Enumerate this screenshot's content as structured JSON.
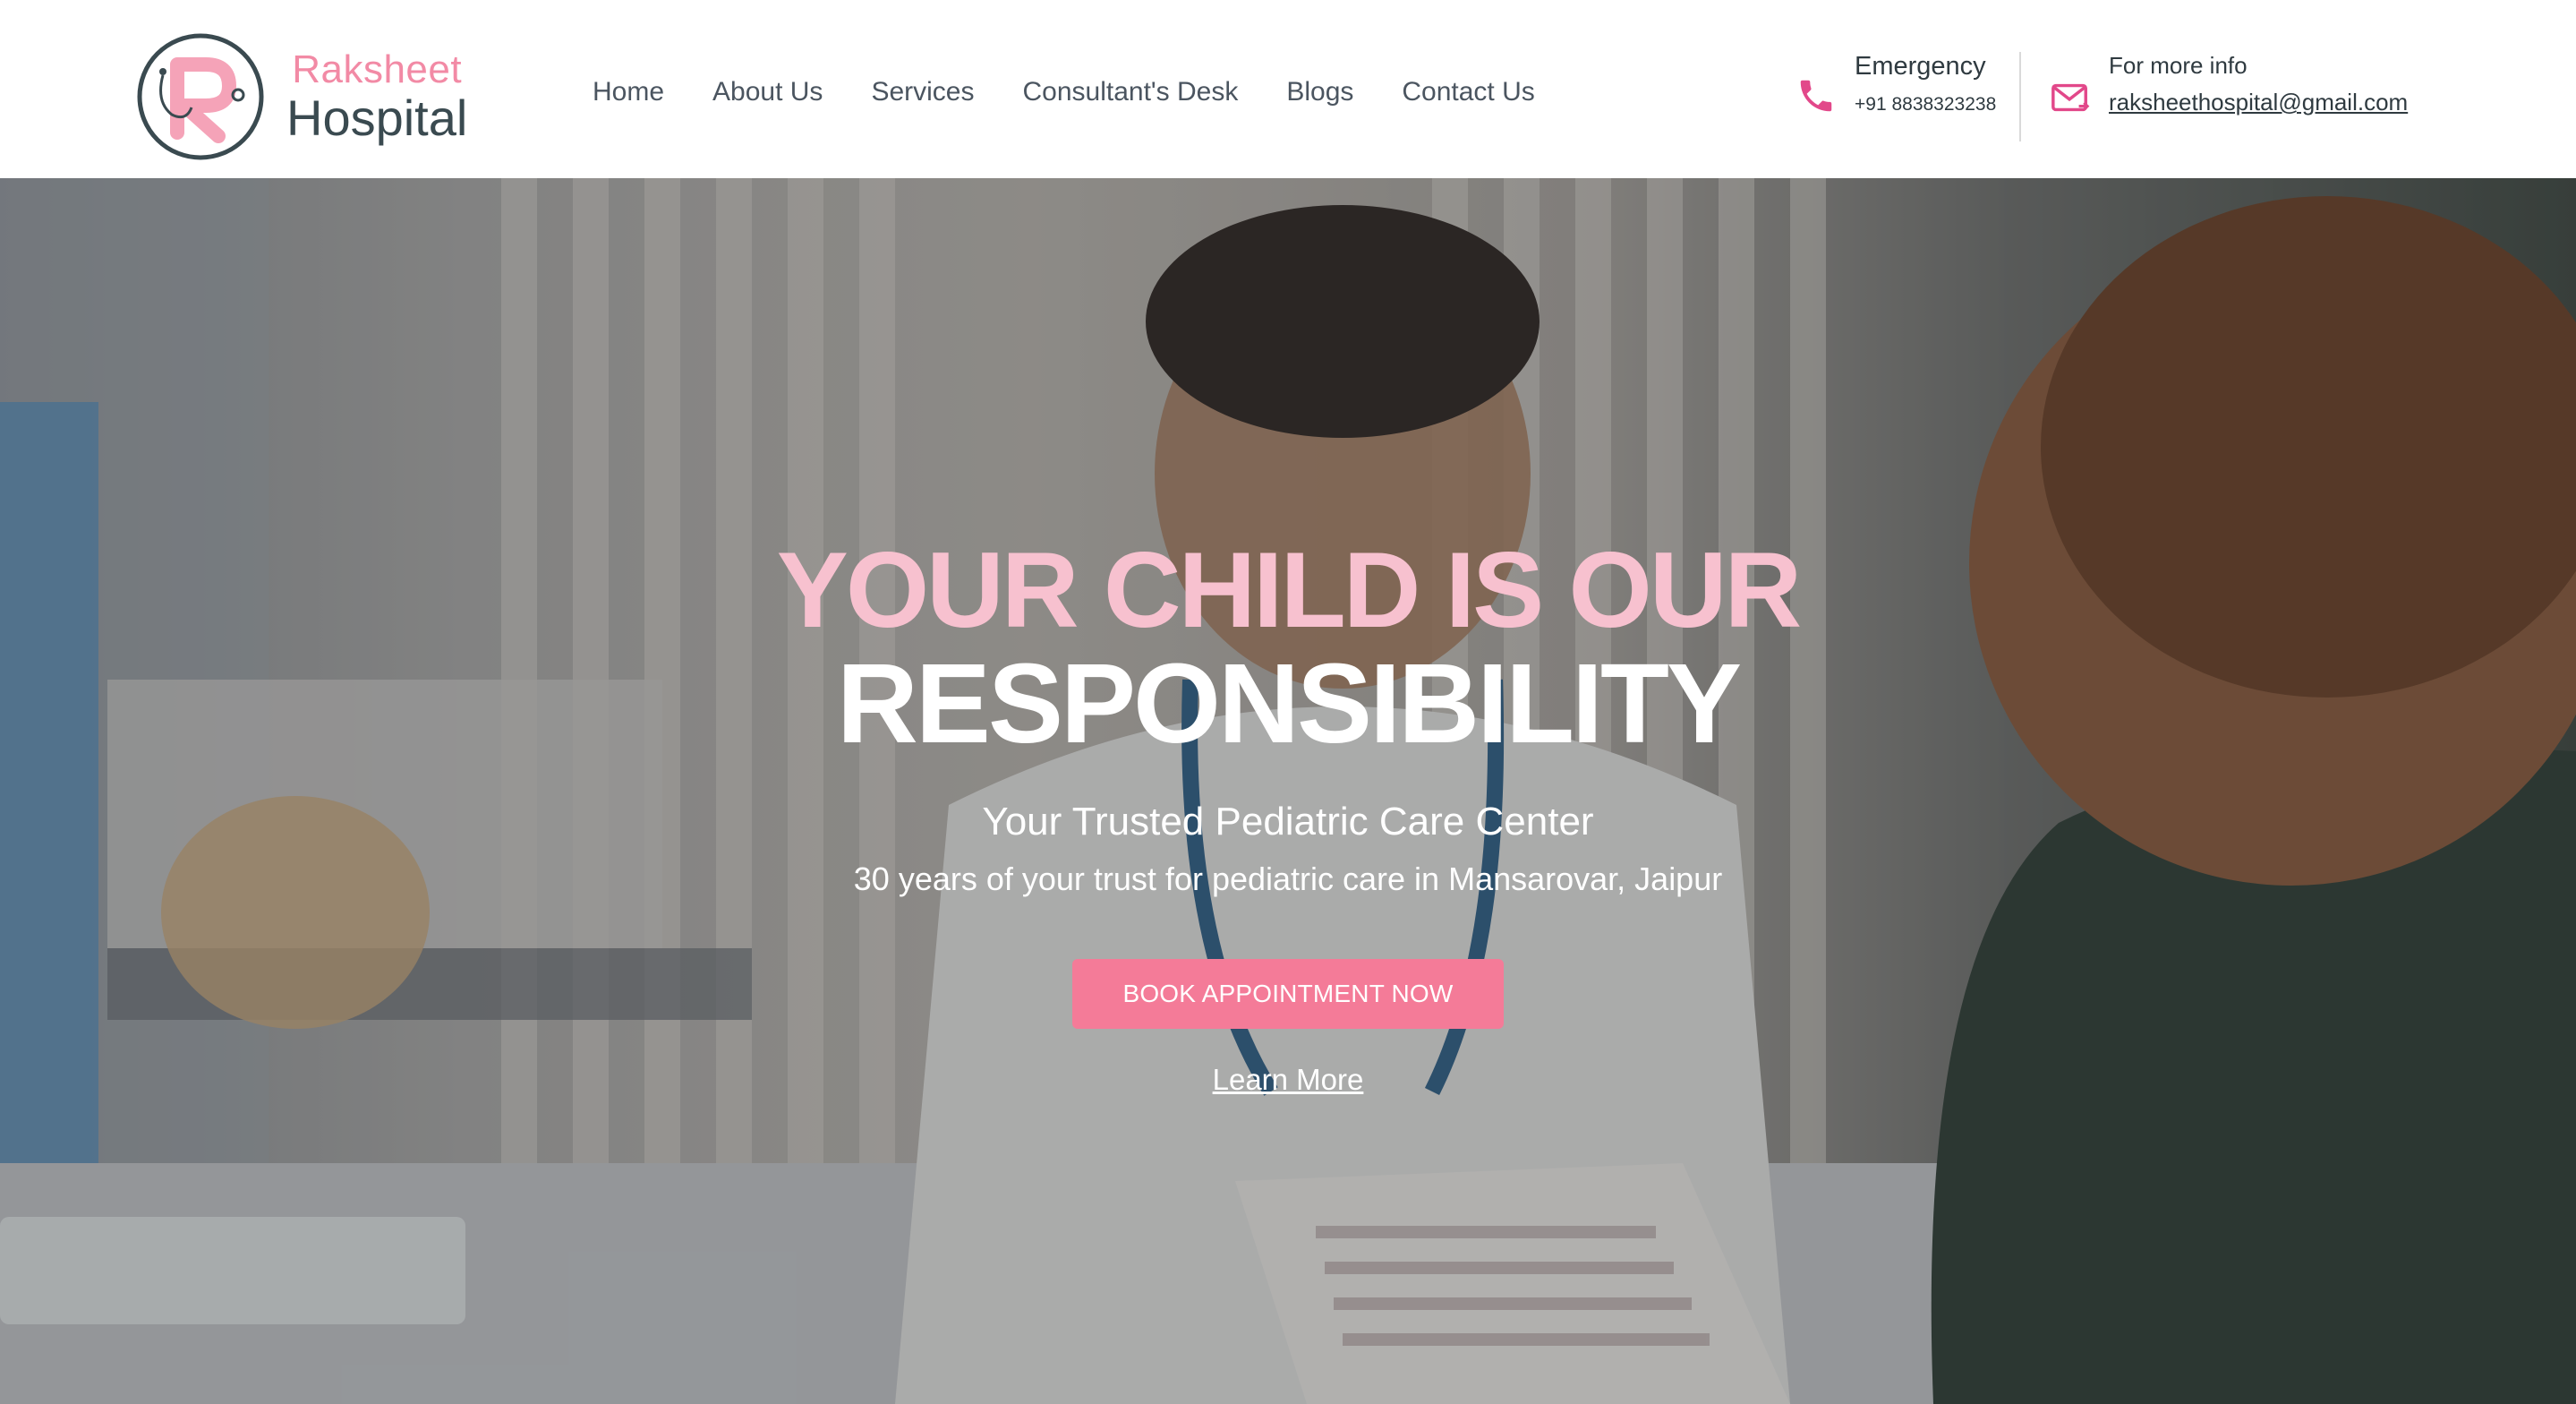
{
  "brand": {
    "name_line1": "Raksheet",
    "name_line2": "Hospital",
    "accent_color": "#f28aa5",
    "dark_color": "#3a4a50"
  },
  "nav": {
    "items": [
      {
        "label": "Home"
      },
      {
        "label": "About Us"
      },
      {
        "label": "Services"
      },
      {
        "label": "Consultant's Desk"
      },
      {
        "label": "Blogs"
      },
      {
        "label": "Contact Us"
      }
    ]
  },
  "contact": {
    "emergency": {
      "title": "Emergency",
      "phone": "+91 8838323238",
      "icon": "phone-icon"
    },
    "info": {
      "title": "For more info",
      "email": "raksheethospital@gmail.com",
      "icon": "mail-icon"
    }
  },
  "hero": {
    "headline_line1": "YOUR CHILD IS OUR",
    "headline_line2": "RESPONSIBILITY",
    "subtitle": "Your Trusted Pediatric Care Center",
    "tagline": "30 years of your trust for pediatric care in Mansarovar, Jaipur",
    "cta_label": "BOOK APPOINTMENT NOW",
    "learn_more_label": "Learn More",
    "cta_color": "#f47b98"
  }
}
